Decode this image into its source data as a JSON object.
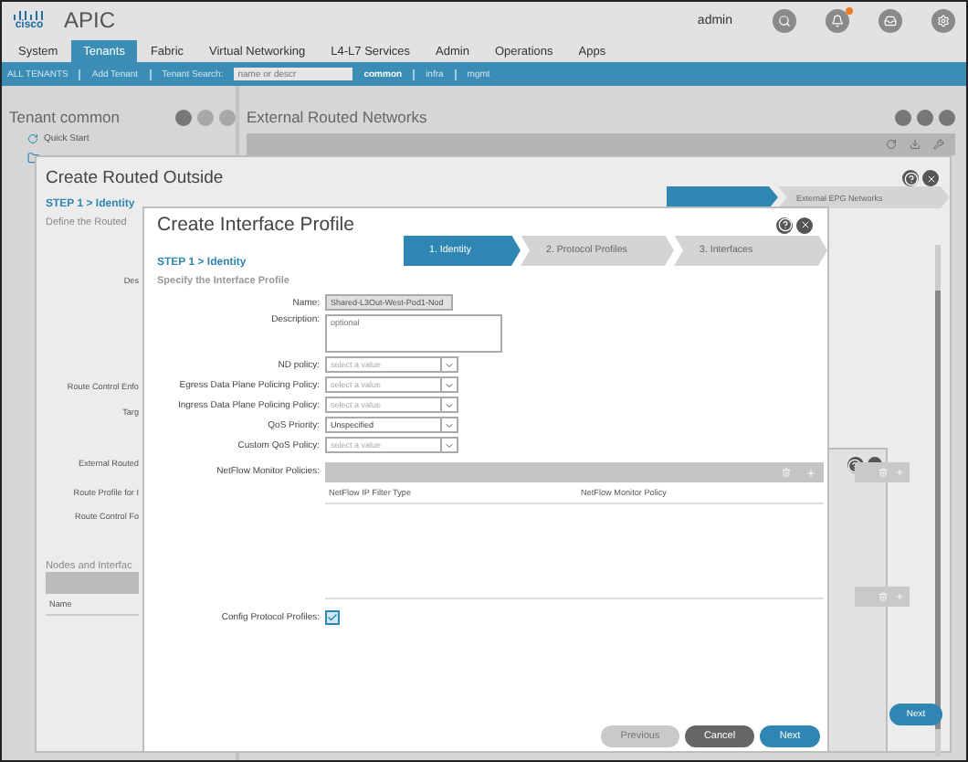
{
  "header": {
    "logo": "cisco",
    "product": "APIC",
    "user": "admin"
  },
  "tabs": [
    {
      "label": "System",
      "selected": false
    },
    {
      "label": "Tenants",
      "selected": true
    },
    {
      "label": "Fabric",
      "selected": false
    },
    {
      "label": "Virtual Networking",
      "selected": false
    },
    {
      "label": "L4-L7 Services",
      "selected": false
    },
    {
      "label": "Admin",
      "selected": false
    },
    {
      "label": "Operations",
      "selected": false
    },
    {
      "label": "Apps",
      "selected": false
    }
  ],
  "subnav": {
    "all_tenants": "ALL TENANTS",
    "add_tenant": "Add Tenant",
    "search_label": "Tenant Search:",
    "search_placeholder": "name or descr",
    "tenants": [
      {
        "label": "common",
        "selected": true
      },
      {
        "label": "infra",
        "selected": false
      },
      {
        "label": "mgmt",
        "selected": false
      }
    ]
  },
  "tenant_panel": {
    "title": "Tenant common",
    "quick_start": "Quick Start"
  },
  "content_panel": {
    "title": "External Routed Networks"
  },
  "routed_outside_dialog": {
    "title": "Create Routed Outside",
    "step": "STEP 1 > Identity",
    "subtitle": "Define the Routed",
    "labels": [
      "Des",
      "Route Control Enfo",
      "Targ",
      "External Routed",
      "Route Profile for I",
      "Route Control Fo"
    ],
    "section": "Nodes and Interfac",
    "column": "Name",
    "wizard": [
      {
        "selected": true
      },
      {
        "label": "External EPG Networks",
        "selected": false
      }
    ],
    "next": "Next"
  },
  "interface_profile_dialog": {
    "title": "Create Interface Profile",
    "wizard": [
      {
        "label": "1. Identity",
        "selected": true
      },
      {
        "label": "2. Protocol Profiles",
        "selected": false
      },
      {
        "label": "3. Interfaces",
        "selected": false
      }
    ],
    "step": "STEP 1 > Identity",
    "subtitle": "Specify the Interface Profile",
    "fields": [
      {
        "kind": "text",
        "label": "Name:",
        "value": "Shared-L3Out-West-Pod1-Nod"
      },
      {
        "kind": "textarea",
        "label": "Description:",
        "placeholder": "optional"
      },
      {
        "kind": "select",
        "label": "ND policy:",
        "placeholder": "select a value"
      },
      {
        "kind": "select",
        "label": "Egress Data Plane Policing Policy:",
        "placeholder": "select a value"
      },
      {
        "kind": "select",
        "label": "Ingress Data Plane Policing Policy:",
        "placeholder": "select a value"
      },
      {
        "kind": "select",
        "label": "QoS Priority:",
        "value": "Unspecified"
      },
      {
        "kind": "select",
        "label": "Custom QoS Policy:",
        "placeholder": "select a value"
      }
    ],
    "netflow": {
      "label": "NetFlow Monitor Policies:",
      "columns": [
        "NetFlow IP Filter Type",
        "NetFlow Monitor Policy"
      ]
    },
    "config": {
      "label": "Config Protocol Profiles:",
      "checked": true
    },
    "buttons": [
      {
        "kind": "light",
        "label": "Previous"
      },
      {
        "kind": "dark",
        "label": "Cancel"
      },
      {
        "kind": "primary",
        "label": "Next"
      }
    ]
  }
}
